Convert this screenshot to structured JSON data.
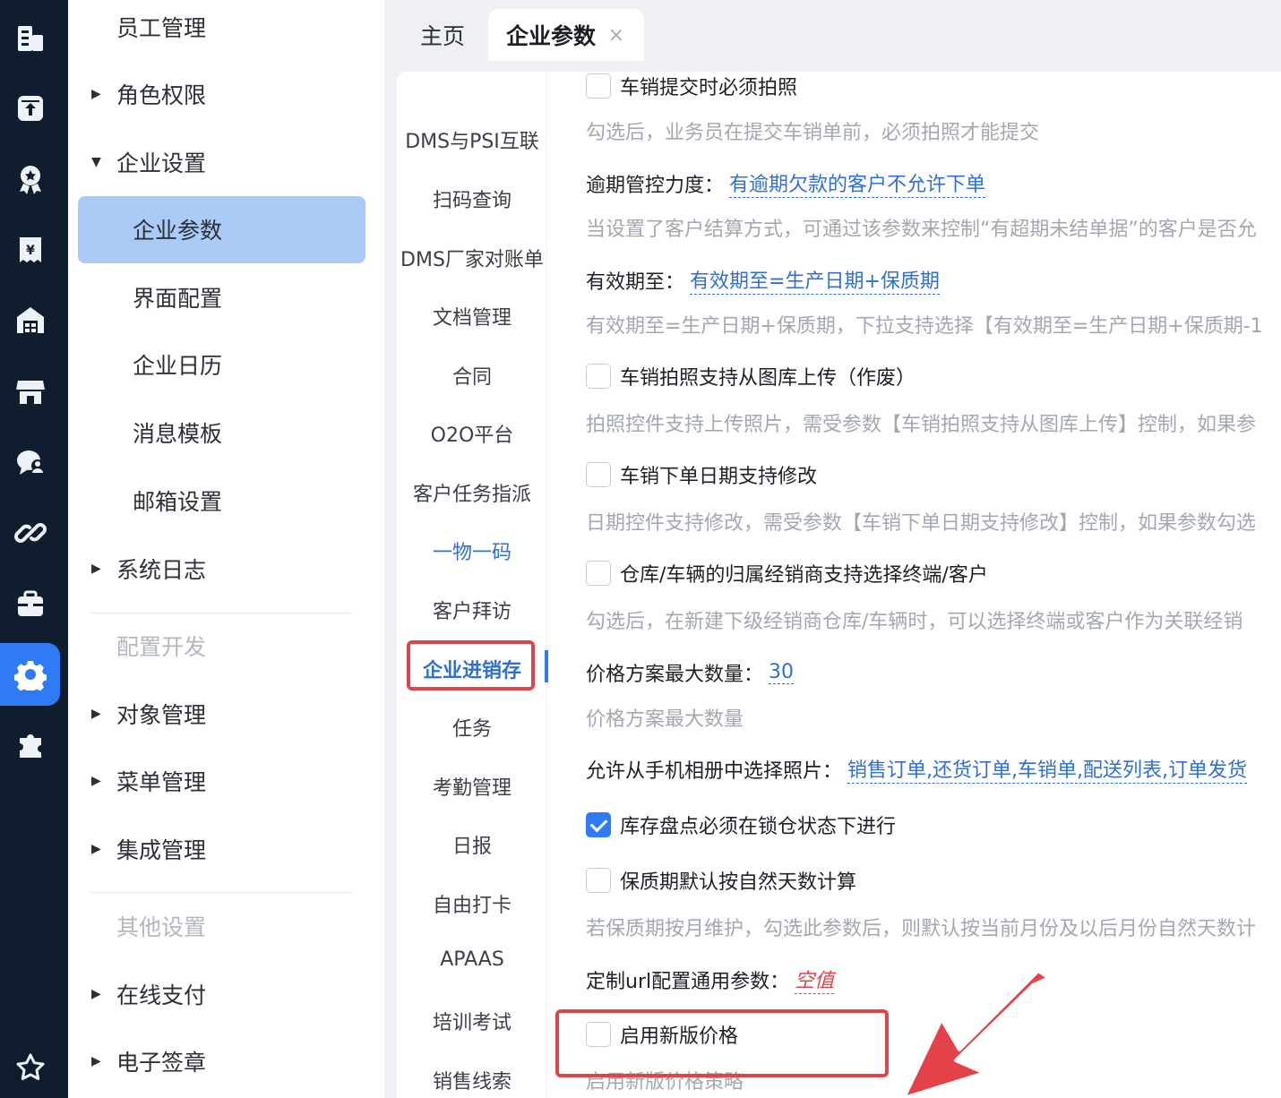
{
  "rail": {
    "icons": [
      "building-icon",
      "inbox-upload-icon",
      "award-icon",
      "receipt-icon",
      "warehouse-icon",
      "store-icon",
      "chat-icon",
      "link-icon",
      "toolbox-icon",
      "gear-icon",
      "puzzle-icon",
      "star-icon"
    ],
    "active": "gear-icon"
  },
  "menu": {
    "items": [
      {
        "label": "员工管理",
        "kind": "sub-top"
      },
      {
        "label": "角色权限",
        "kind": "collapsed"
      },
      {
        "label": "企业设置",
        "kind": "expanded"
      },
      {
        "label": "企业参数",
        "kind": "sub",
        "active": true
      },
      {
        "label": "界面配置",
        "kind": "sub"
      },
      {
        "label": "企业日历",
        "kind": "sub"
      },
      {
        "label": "消息模板",
        "kind": "sub"
      },
      {
        "label": "邮箱设置",
        "kind": "sub"
      },
      {
        "label": "系统日志",
        "kind": "collapsed"
      },
      {
        "label": "配置开发",
        "kind": "group"
      },
      {
        "label": "对象管理",
        "kind": "collapsed"
      },
      {
        "label": "菜单管理",
        "kind": "collapsed"
      },
      {
        "label": "集成管理",
        "kind": "collapsed"
      },
      {
        "label": "其他设置",
        "kind": "group"
      },
      {
        "label": "在线支付",
        "kind": "collapsed"
      },
      {
        "label": "电子签章",
        "kind": "collapsed"
      }
    ]
  },
  "tabs": {
    "home": "主页",
    "current": "企业参数",
    "close_glyph": "×"
  },
  "subnav": {
    "items": [
      "DMS与PSI互联",
      "扫码查询",
      "DMS厂家对账单",
      "文档管理",
      "合同",
      "O2O平台",
      "客户任务指派",
      "一物一码",
      "客户拜访",
      "企业进销存",
      "任务",
      "考勤管理",
      "日报",
      "自由打卡",
      "APAAS",
      "培训考试",
      "销售线索"
    ],
    "selected": "企业进销存"
  },
  "params": {
    "p1": {
      "label": "车销提交时必须拍照",
      "checked": false,
      "desc": "勾选后，业务员在提交车销单前，必须拍照才能提交"
    },
    "p2": {
      "label": "逾期管控力度：",
      "value": "有逾期欠款的客户不允许下单",
      "desc": "当设置了客户结算方式，可通过该参数来控制“有超期未结单据”的客户是否允"
    },
    "p3": {
      "label": "有效期至：",
      "value": "有效期至=生产日期+保质期",
      "desc": "有效期至=生产日期+保质期，下拉支持选择【有效期至=生产日期+保质期-1"
    },
    "p4": {
      "label": "车销拍照支持从图库上传（作废）",
      "checked": false,
      "desc": "拍照控件支持上传照片，需受参数【车销拍照支持从图库上传】控制，如果参"
    },
    "p5": {
      "label": "车销下单日期支持修改",
      "checked": false,
      "desc": "日期控件支持修改，需受参数【车销下单日期支持修改】控制，如果参数勾选"
    },
    "p6": {
      "label": "仓库/车辆的归属经销商支持选择终端/客户",
      "checked": false,
      "desc": "勾选后，在新建下级经销商仓库/车辆时，可以选择终端或客户作为关联经销"
    },
    "p7": {
      "label": "价格方案最大数量：",
      "value": "30",
      "desc": "价格方案最大数量"
    },
    "p8": {
      "label": "允许从手机相册中选择照片：",
      "value": "销售订单,还货订单,车销单,配送列表,订单发货"
    },
    "p9": {
      "label": "库存盘点必须在锁仓状态下进行",
      "checked": true
    },
    "p10": {
      "label": "保质期默认按自然天数计算",
      "checked": false,
      "desc": "若保质期按月维护，勾选此参数后，则默认按当前月份及以后月份自然天数计"
    },
    "p11": {
      "label": "定制url配置通用参数：",
      "value": "空值"
    },
    "p12": {
      "label": "启用新版价格",
      "checked": false,
      "desc": "启用新版价格策略"
    }
  },
  "colors": {
    "rail_bg": "#0f1d2e",
    "accent": "#2f7bf5",
    "menu_active_bg": "#a9cbf5",
    "annotation_red": "#e3424a",
    "link": "#2f6fd6"
  }
}
